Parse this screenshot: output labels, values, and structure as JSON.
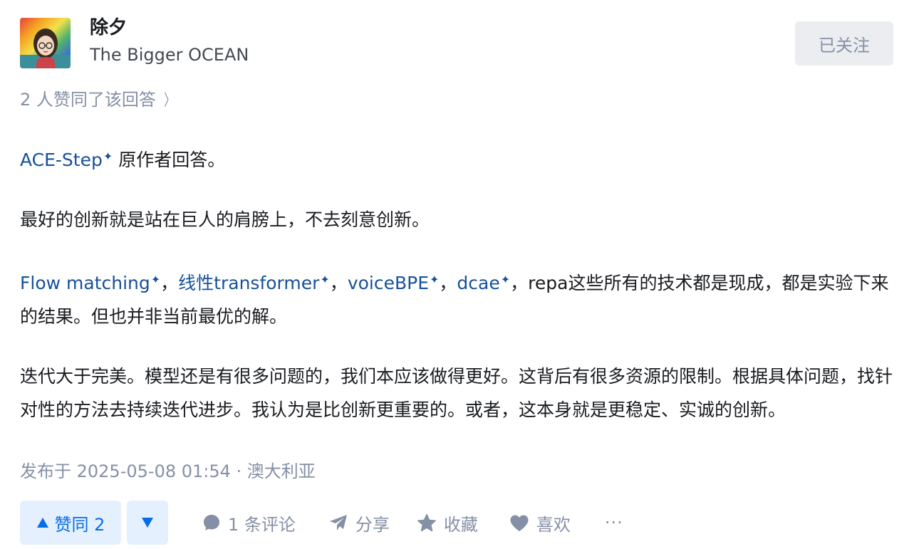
{
  "author": {
    "name": "除夕",
    "headline": "The Bigger OCEAN",
    "follow_label": "已关注"
  },
  "voters_text": "2 人赞同了该回答",
  "content": {
    "p1": {
      "link": "ACE-Step",
      "text": " 原作者回答。"
    },
    "p2": "最好的创新就是站在巨人的肩膀上，不去刻意创新。",
    "p3": {
      "link1": "Flow matching",
      "sep1": "，",
      "link2": "线性transformer",
      "sep2": "，",
      "link3": "voiceBPE",
      "sep3": "，",
      "link4": "dcae",
      "rest": "，repa这些所有的技术都是现成，都是实验下来的结果。但也并非当前最优的解。"
    },
    "p4": "迭代大于完美。模型还是有很多问题的，我们本应该做得更好。这背后有很多资源的限制。根据具体问题，找针对性的方法去持续迭代进步。我认为是比创新更重要的。或者，这本身就是更稳定、实诚的创新。"
  },
  "meta": "发布于 2025-05-08 01:54 · 澳大利亚",
  "actions": {
    "upvote_label": "赞同 2",
    "comment_label": "1 条评论",
    "share_label": "分享",
    "collect_label": "收藏",
    "like_label": "喜欢",
    "more_label": "···"
  },
  "colors": {
    "link": "#175199",
    "accent": "#056de8",
    "muted": "#8590a6"
  },
  "icons": [
    "chevron-right-icon",
    "spark-icon",
    "triangle-up-icon",
    "triangle-down-icon",
    "comment-icon",
    "share-icon",
    "star-icon",
    "heart-icon",
    "more-icon"
  ]
}
